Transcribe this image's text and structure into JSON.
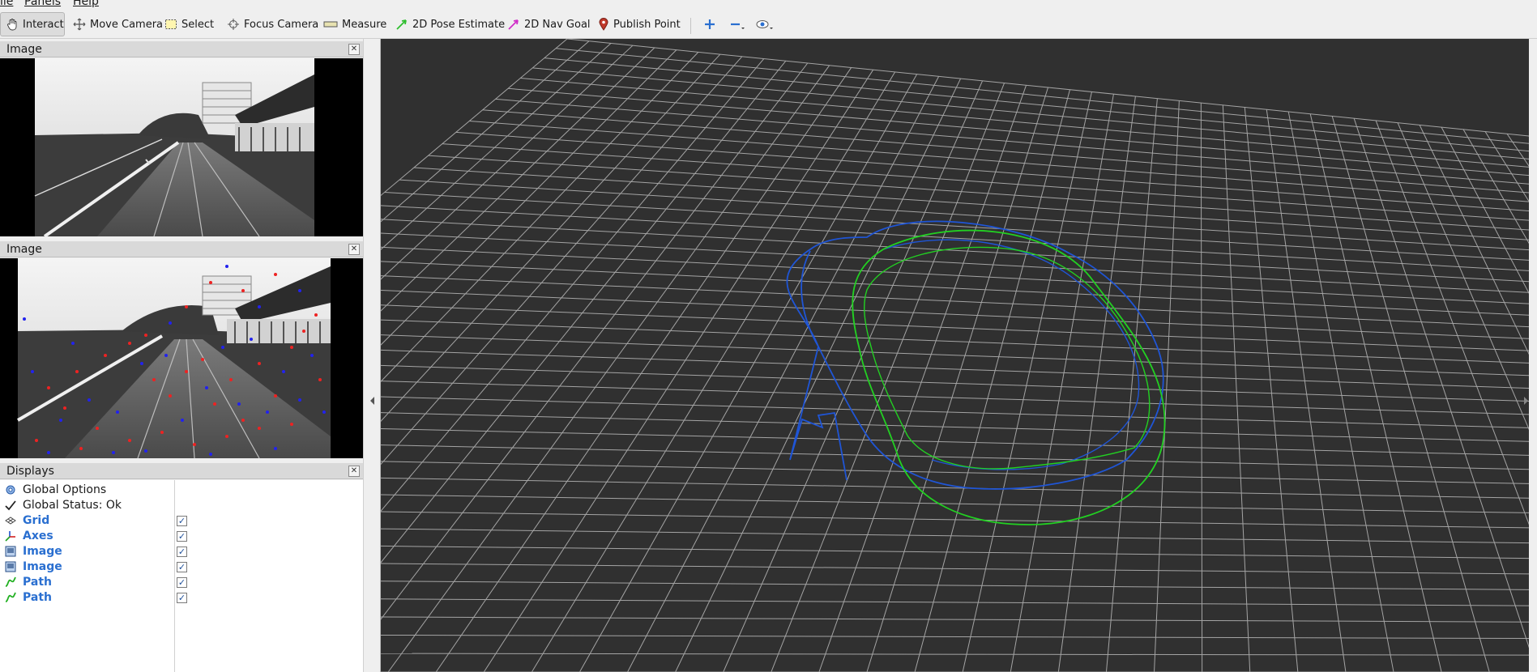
{
  "menu": {
    "file": "ile",
    "panels": "Panels",
    "help": "Help"
  },
  "toolbar": {
    "interact": "Interact",
    "move_camera": "Move Camera",
    "select": "Select",
    "focus_camera": "Focus Camera",
    "measure": "Measure",
    "pose_estimate": "2D Pose Estimate",
    "nav_goal": "2D Nav Goal",
    "publish_point": "Publish Point"
  },
  "image_panel_1": {
    "title": "Image"
  },
  "image_panel_2": {
    "title": "Image"
  },
  "displays": {
    "title": "Displays",
    "items": [
      {
        "label": "Global Options",
        "icon": "gear-icon",
        "checked": null
      },
      {
        "label": "Global Status: Ok",
        "icon": "checkmark-icon",
        "checked": null
      },
      {
        "label": "Grid",
        "icon": "grid-icon",
        "checked": true
      },
      {
        "label": "Axes",
        "icon": "axes-icon",
        "checked": true
      },
      {
        "label": "Image",
        "icon": "image-icon",
        "checked": true
      },
      {
        "label": "Image",
        "icon": "image-icon",
        "checked": true
      },
      {
        "label": "Path",
        "icon": "path-icon",
        "checked": true
      },
      {
        "label": "Path",
        "icon": "path-icon",
        "checked": true
      }
    ]
  },
  "colors": {
    "viewport_bg": "#303030",
    "grid_line": "#a0a0a0",
    "path_blue": "#1f55d6",
    "path_green": "#22d022",
    "display_label_blue": "#2a6fd0"
  }
}
